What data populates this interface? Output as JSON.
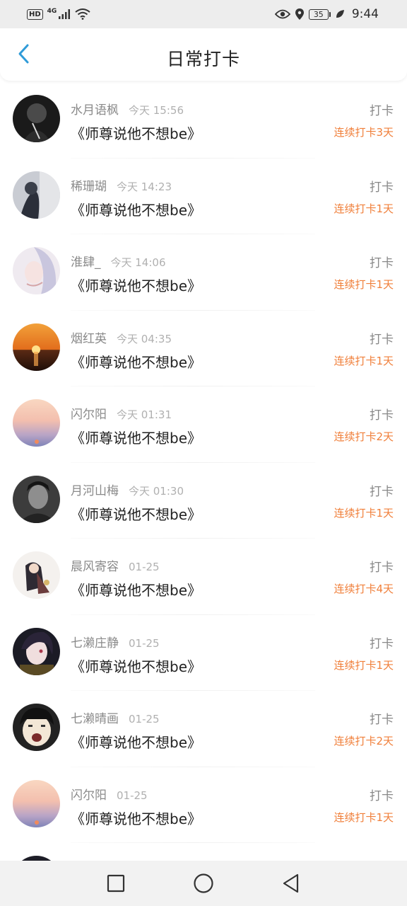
{
  "status_bar": {
    "hd": "HD",
    "network": "4G",
    "battery": "35",
    "time": "9:44"
  },
  "header": {
    "title": "日常打卡"
  },
  "checkins": [
    {
      "name": "水月语枫",
      "time": "今天 15:56",
      "book": "《师尊说他不想be》",
      "action": "打卡",
      "streak": "连续打卡3天"
    },
    {
      "name": "稀珊瑚",
      "time": "今天 14:23",
      "book": "《师尊说他不想be》",
      "action": "打卡",
      "streak": "连续打卡1天"
    },
    {
      "name": "淮肆_",
      "time": "今天 14:06",
      "book": "《师尊说他不想be》",
      "action": "打卡",
      "streak": "连续打卡1天"
    },
    {
      "name": "烟红英",
      "time": "今天 04:35",
      "book": "《师尊说他不想be》",
      "action": "打卡",
      "streak": "连续打卡1天"
    },
    {
      "name": "闪尔阳",
      "time": "今天 01:31",
      "book": "《师尊说他不想be》",
      "action": "打卡",
      "streak": "连续打卡2天"
    },
    {
      "name": "月河山梅",
      "time": "今天 01:30",
      "book": "《师尊说他不想be》",
      "action": "打卡",
      "streak": "连续打卡1天"
    },
    {
      "name": "晨风寄容",
      "time": "01-25",
      "book": "《师尊说他不想be》",
      "action": "打卡",
      "streak": "连续打卡4天"
    },
    {
      "name": "七濑庄静",
      "time": "01-25",
      "book": "《师尊说他不想be》",
      "action": "打卡",
      "streak": "连续打卡1天"
    },
    {
      "name": "七濑晴画",
      "time": "01-25",
      "book": "《师尊说他不想be》",
      "action": "打卡",
      "streak": "连续打卡2天"
    },
    {
      "name": "闪尔阳",
      "time": "01-25",
      "book": "《师尊说他不想be》",
      "action": "打卡",
      "streak": "连续打卡1天"
    }
  ],
  "icons": {
    "back": "chevron-left-icon",
    "recents": "square-icon",
    "home": "circle-icon",
    "nav_back": "triangle-back-icon"
  },
  "colors": {
    "accent": "#2f9bd8",
    "streak": "#f07f3a"
  }
}
